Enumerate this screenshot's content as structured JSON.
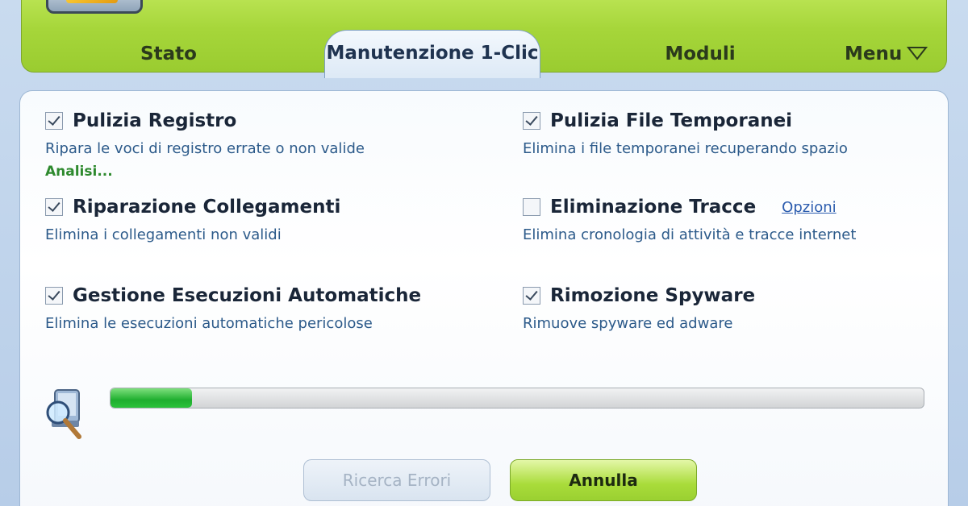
{
  "tabs": {
    "stato": "Stato",
    "manutenzione": "Manutenzione 1-Clic",
    "moduli": "Moduli",
    "menu": "Menu"
  },
  "items": {
    "registro": {
      "title": "Pulizia Registro",
      "desc": "Ripara le voci di registro errate o non valide",
      "status": "Analisi...",
      "checked": true
    },
    "file_temp": {
      "title": "Pulizia File Temporanei",
      "desc": "Elimina i file temporanei recuperando spazio",
      "checked": true
    },
    "collegamenti": {
      "title": "Riparazione Collegamenti",
      "desc": "Elimina i collegamenti non validi",
      "checked": true
    },
    "tracce": {
      "title": "Eliminazione Tracce",
      "desc": "Elimina cronologia di attività e tracce internet",
      "link": "Opzioni",
      "checked": false
    },
    "esecuzioni": {
      "title": "Gestione Esecuzioni Automatiche",
      "desc": "Elimina le esecuzioni automatiche pericolose",
      "checked": true
    },
    "spyware": {
      "title": "Rimozione Spyware",
      "desc": "Rimuove spyware ed adware",
      "checked": true
    }
  },
  "progress": {
    "percent": 10
  },
  "buttons": {
    "ricerca": "Ricerca Errori",
    "annulla": "Annulla"
  },
  "colors": {
    "accent_green": "#a6d63a",
    "progress_green": "#1fae2f",
    "status_green": "#2e8a2e",
    "link_blue": "#2b5cae"
  }
}
